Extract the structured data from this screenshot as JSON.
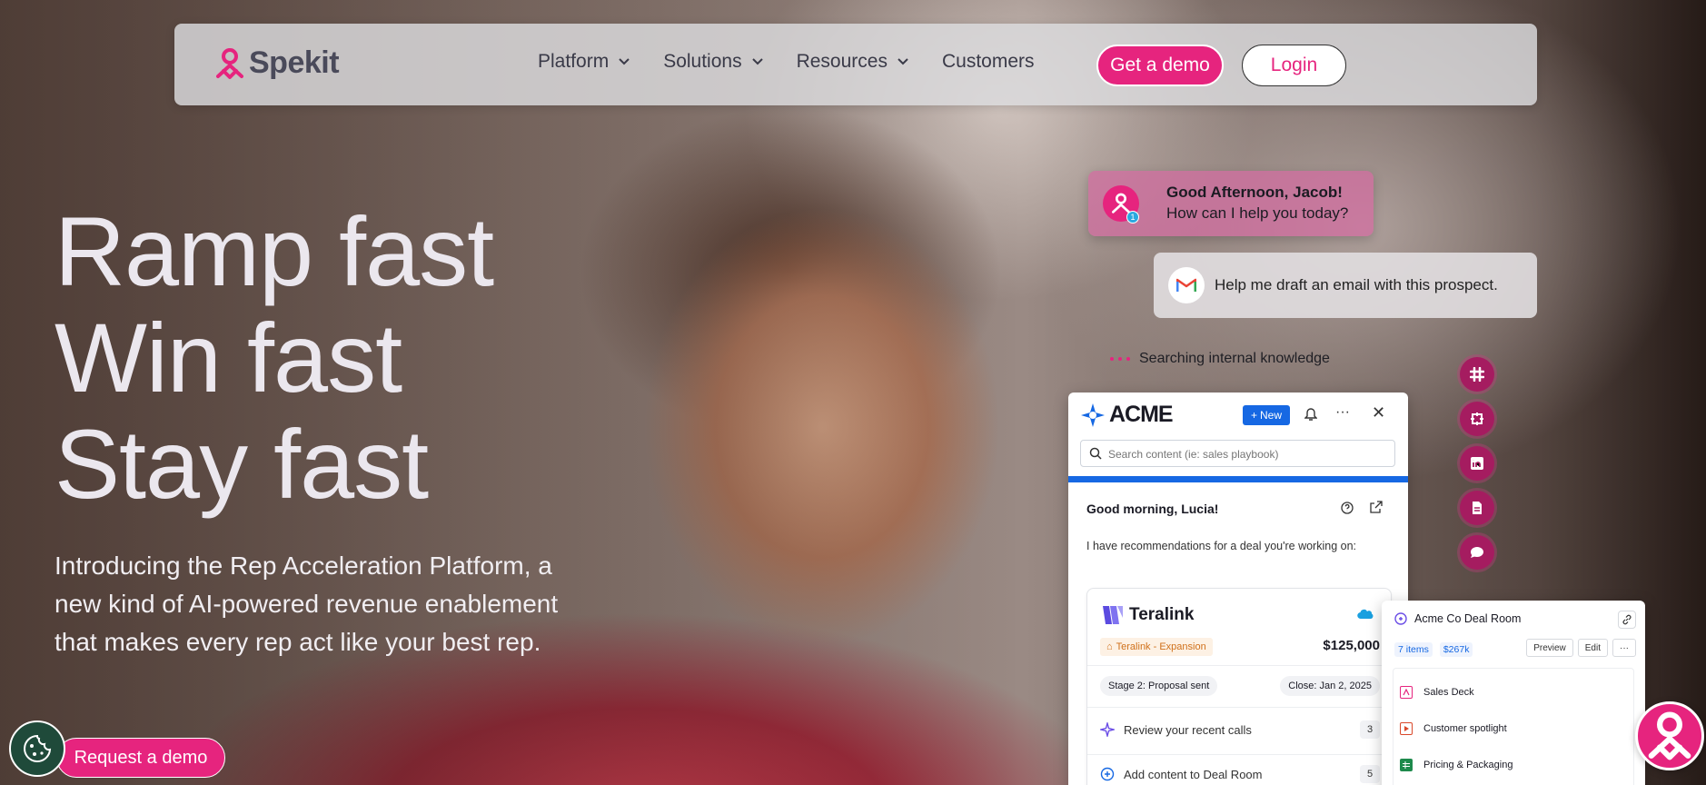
{
  "brand": {
    "name": "Spekit",
    "accent": "#e6247e"
  },
  "nav": {
    "items": [
      {
        "label": "Platform",
        "dropdown": true
      },
      {
        "label": "Solutions",
        "dropdown": true
      },
      {
        "label": "Resources",
        "dropdown": true
      },
      {
        "label": "Customers",
        "dropdown": false
      }
    ],
    "demo_label": "Get a demo",
    "login_label": "Login"
  },
  "hero": {
    "title_lines": [
      "Ramp fast",
      "Win fast",
      "Stay fast"
    ],
    "subtitle": "Introducing the Rep Acceleration Platform, a new kind of AI-powered revenue enablement that makes every rep act like your best rep.",
    "cta_label": "Request a demo"
  },
  "assistant": {
    "greeting_title": "Good Afternoon, Jacob!",
    "greeting_sub": "How can I help you today?",
    "badge_count": "1",
    "mail_prompt": "Help me draft an email with this prospect.",
    "status": "Searching internal knowledge",
    "side_icons": [
      "slack-icon",
      "integration-icon",
      "linkedin-icon",
      "document-icon",
      "chat-icon"
    ]
  },
  "acme": {
    "name": "ACME",
    "new_label": "New",
    "search_placeholder": "Search content (ie: sales playbook)",
    "greeting": "Good morning, Lucia!",
    "recommendation": "I have recommendations for a deal you're working on:",
    "deal": {
      "company": "Teralink",
      "tag": "Teralink - Expansion",
      "amount": "$125,000",
      "stage": "Stage 2: Proposal sent",
      "close": "Close: Jan 2, 2025",
      "tasks": [
        {
          "label": "Review your recent calls",
          "count": "3"
        },
        {
          "label": "Add content to Deal Room",
          "count": "5"
        }
      ]
    }
  },
  "dealroom": {
    "title": "Acme Co Deal Room",
    "items_count": "7 items",
    "value": "$267k",
    "buttons": [
      "Preview",
      "Edit"
    ],
    "files": [
      {
        "name": "Sales Deck",
        "color": "#e6247e"
      },
      {
        "name": "Customer spotlight",
        "color": "#d9482a"
      },
      {
        "name": "Pricing & Packaging",
        "color": "#1e8a4c"
      }
    ]
  }
}
